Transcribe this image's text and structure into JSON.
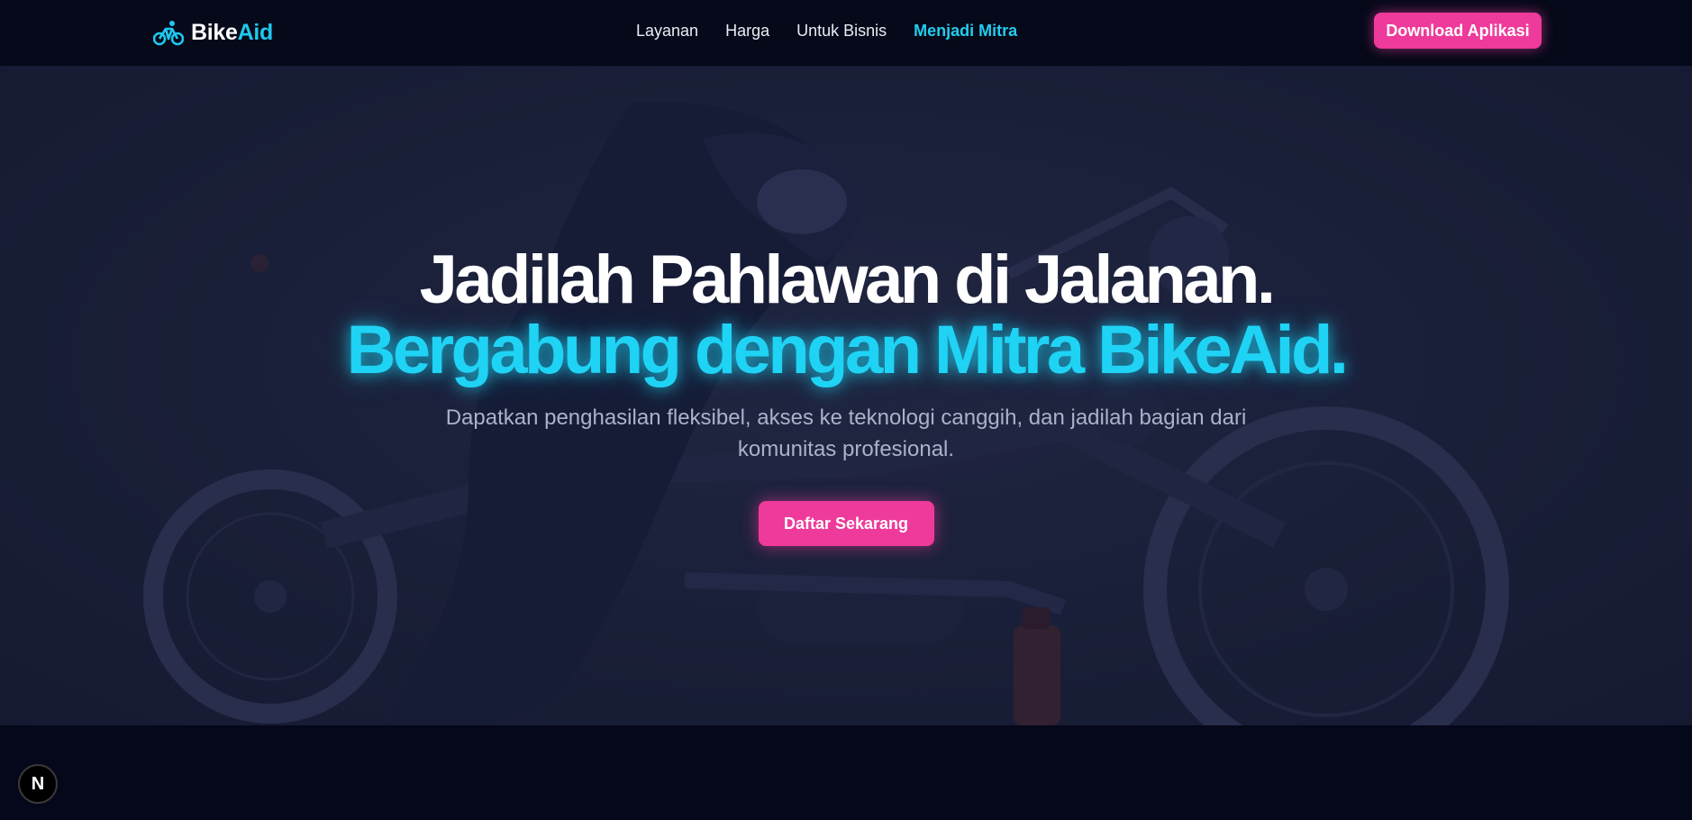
{
  "navbar": {
    "brand": {
      "part1": "Bike",
      "part2": "Aid",
      "icon": "bicycle-icon"
    },
    "links": [
      {
        "label": "Layanan",
        "active": false
      },
      {
        "label": "Harga",
        "active": false
      },
      {
        "label": "Untuk Bisnis",
        "active": false
      },
      {
        "label": "Menjadi Mitra",
        "active": true
      }
    ],
    "download_label": "Download Aplikasi"
  },
  "hero": {
    "title_line1": "Jadilah Pahlawan di Jalanan.",
    "title_line2": "Bergabung dengan Mitra BikeAid.",
    "subtitle": "Dapatkan penghasilan fleksibel, akses ke teknologi canggih, dan jadilah bagian dari komunitas profesional.",
    "cta_label": "Daftar Sekarang",
    "background_image": "mechanic-repairing-motorcycle"
  },
  "dev_badge": {
    "label": "N"
  },
  "colors": {
    "accent_cyan": "#1fd3f5",
    "accent_pink": "#ee3a9a",
    "nav_bg": "#060919",
    "page_bg": "#05071a"
  }
}
